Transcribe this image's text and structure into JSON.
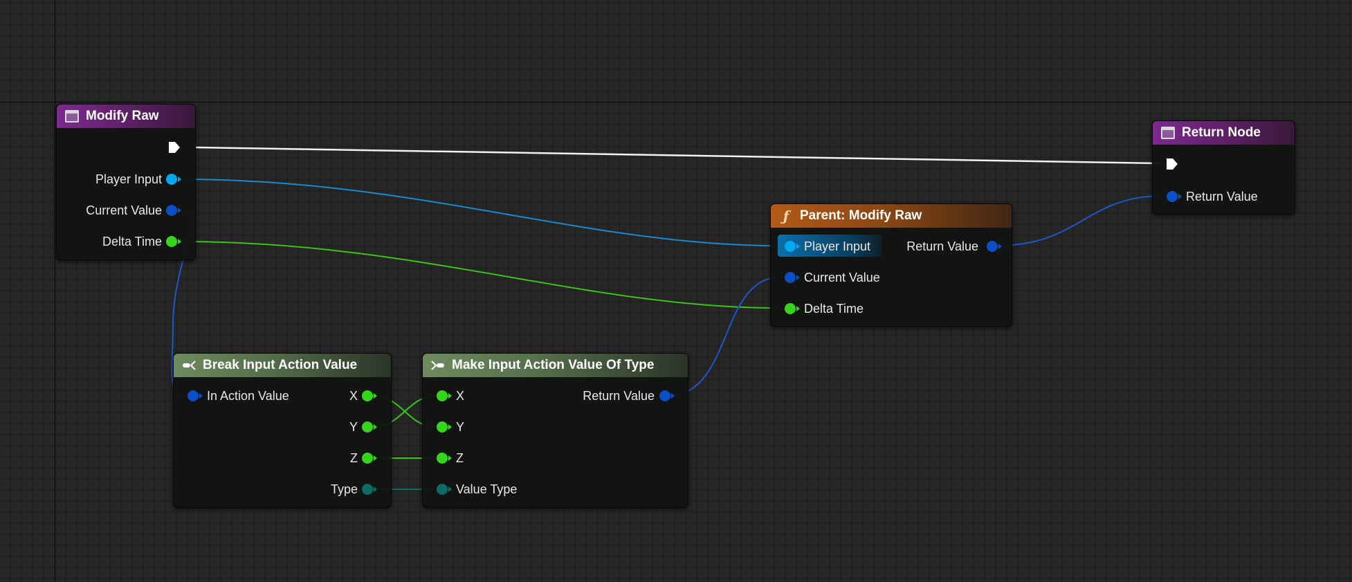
{
  "nodes": {
    "modify_raw": {
      "title": "Modify Raw",
      "pins": [
        "Player Input",
        "Current Value",
        "Delta Time"
      ]
    },
    "return_node": {
      "title": "Return Node",
      "pins": [
        "Return Value"
      ]
    },
    "parent_modify_raw": {
      "title": "Parent: Modify Raw",
      "icon": "function-icon",
      "inputs": [
        "Player Input",
        "Current Value",
        "Delta Time"
      ],
      "outputs": [
        "Return Value"
      ]
    },
    "break_input_action_value": {
      "title": "Break Input Action Value",
      "inputs": [
        "In Action Value"
      ],
      "outputs": [
        "X",
        "Y",
        "Z",
        "Type"
      ]
    },
    "make_input_action_value": {
      "title": "Make Input Action Value Of Type",
      "inputs": [
        "X",
        "Y",
        "Z",
        "Value Type"
      ],
      "outputs": [
        "Return Value"
      ]
    }
  },
  "colors": {
    "exec_wire": "#ffffff",
    "player_input_wire": "#1a8ad0",
    "action_value_wire": "#1f57c8",
    "float_wire": "#3ac41a",
    "type_wire": "#0e6c66"
  }
}
